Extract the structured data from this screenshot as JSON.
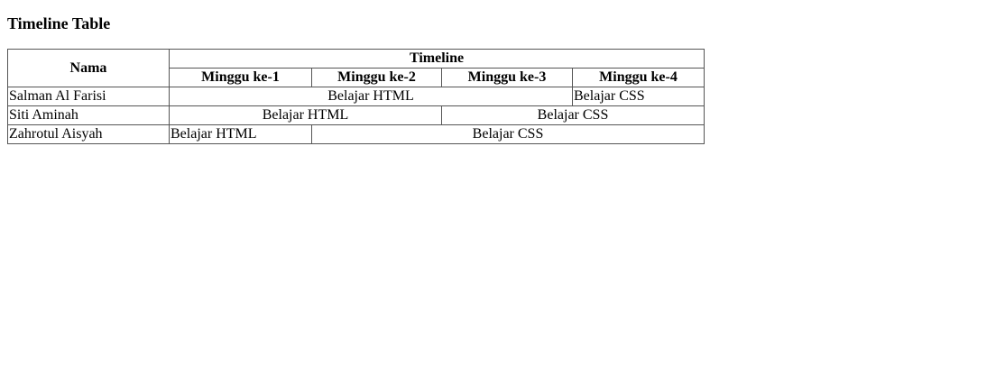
{
  "page": {
    "title": "Timeline Table"
  },
  "table": {
    "headers": {
      "nama": "Nama",
      "timeline": "Timeline",
      "weeks": [
        "Minggu ke-1",
        "Minggu ke-2",
        "Minggu ke-3",
        "Minggu ke-4"
      ]
    },
    "rows": [
      {
        "name": "Salman Al Farisi",
        "cells": [
          "Belajar HTML",
          "Belajar CSS"
        ]
      },
      {
        "name": "Siti Aminah",
        "cells": [
          "Belajar HTML",
          "Belajar CSS"
        ]
      },
      {
        "name": "Zahrotul Aisyah",
        "cells": [
          "Belajar HTML",
          "Belajar CSS"
        ]
      }
    ]
  }
}
